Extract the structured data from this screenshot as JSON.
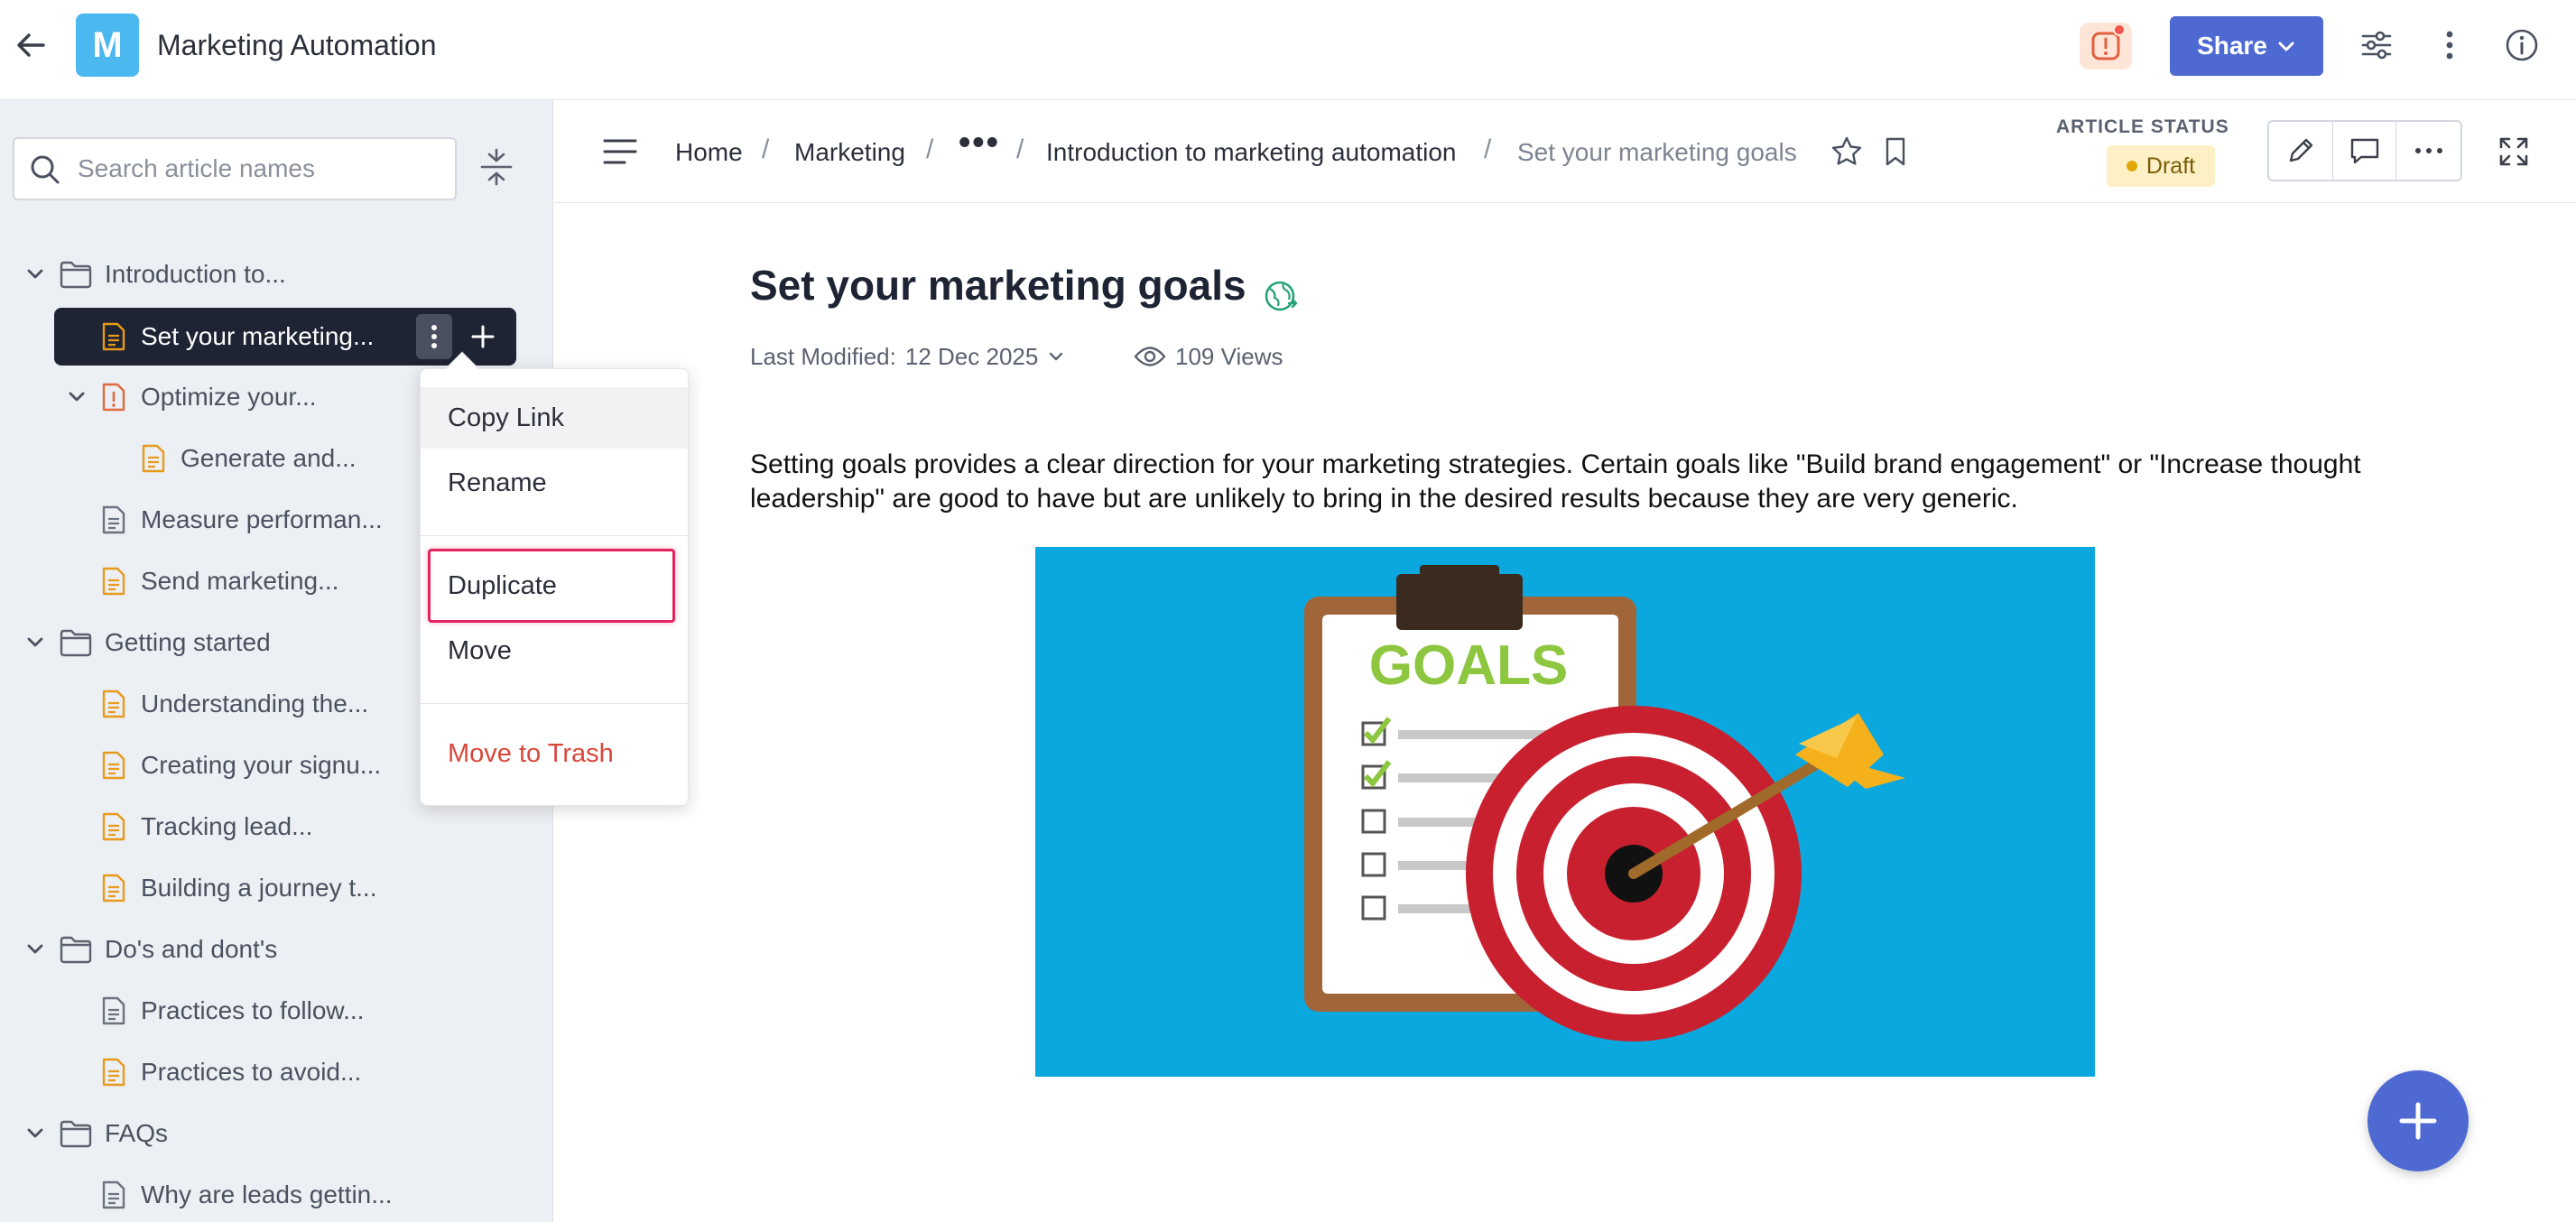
{
  "app": {
    "logo_letter": "M",
    "title": "Marketing Automation",
    "share_label": "Share"
  },
  "sidebar": {
    "search_placeholder": "Search article names",
    "tree": [
      {
        "label": "Introduction to...",
        "type": "folder",
        "expanded": true
      },
      {
        "label": "Set your marketing...",
        "type": "doc",
        "color": "#e89a1c",
        "selected": true
      },
      {
        "label": "Optimize your...",
        "type": "doc",
        "color": "#e06a3c",
        "expanded": true
      },
      {
        "label": "Generate and...",
        "type": "doc",
        "color": "#e89a1c"
      },
      {
        "label": "Measure performan...",
        "type": "doc",
        "color": "#6b7280"
      },
      {
        "label": "Send marketing...",
        "type": "doc",
        "color": "#e89a1c"
      },
      {
        "label": "Getting started",
        "type": "folder",
        "expanded": true
      },
      {
        "label": "Understanding the...",
        "type": "doc",
        "color": "#e89a1c"
      },
      {
        "label": "Creating your signu...",
        "type": "doc",
        "color": "#e89a1c"
      },
      {
        "label": "Tracking lead...",
        "type": "doc",
        "color": "#e89a1c"
      },
      {
        "label": "Building a journey t...",
        "type": "doc",
        "color": "#e89a1c"
      },
      {
        "label": "Do's and dont's",
        "type": "folder",
        "expanded": true
      },
      {
        "label": "Practices to follow...",
        "type": "doc",
        "color": "#6b7280"
      },
      {
        "label": "Practices to avoid...",
        "type": "doc",
        "color": "#e89a1c"
      },
      {
        "label": "FAQs",
        "type": "folder",
        "expanded": true
      },
      {
        "label": "Why are leads gettin...",
        "type": "doc",
        "color": "#6b7280"
      }
    ]
  },
  "context_menu": {
    "copy_link": "Copy Link",
    "rename": "Rename",
    "duplicate": "Duplicate",
    "move": "Move",
    "move_to_trash": "Move to Trash"
  },
  "breadcrumb": {
    "home": "Home",
    "marketing": "Marketing",
    "ellipsis": "•••",
    "parent": "Introduction to marketing automation",
    "current": "Set your marketing goals",
    "separator": "/"
  },
  "status": {
    "label": "ARTICLE STATUS",
    "value": "Draft"
  },
  "article": {
    "title": "Set your marketing goals",
    "modified_label": "Last Modified:",
    "modified_date": "12 Dec 2025",
    "views": "109 Views",
    "body": "Setting goals provides a clear direction for your marketing strategies. Certain goals like \"Build brand engagement\" or \"Increase thought leadership\" are good to have but are unlikely to bring in the desired results because they are very generic.",
    "image_text": "GOALS"
  },
  "colors": {
    "accent": "#4e6ad2",
    "selected_row": "#1e2433",
    "draft_badge": "#fdf0c4",
    "danger": "#d9473c",
    "highlight": "#e2245f",
    "hero_bg": "#0aa8df"
  }
}
